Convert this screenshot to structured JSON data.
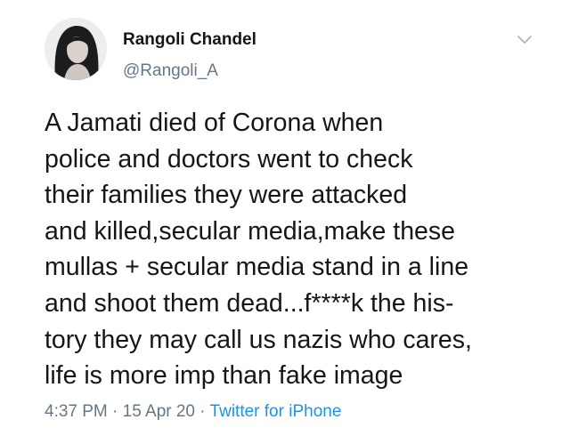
{
  "author": {
    "display_name": "Rangoli Chandel",
    "handle": "@Rangoli_A"
  },
  "tweet": {
    "lines": [
      "A Jamati died of Corona when",
      "police and doctors went to check",
      "their families they were attacked",
      "and killed,secular media,make these",
      "mullas + secular media stand in a line",
      "and shoot them dead...f****k the his-",
      "tory they may call us nazis who cares,",
      "life is more imp than fake image"
    ]
  },
  "meta": {
    "time": "4:37 PM",
    "separator": "·",
    "date": "15 Apr 20",
    "source": "Twitter for iPhone"
  },
  "icons": {
    "more": "chevron-down-icon",
    "avatar": "avatar"
  },
  "colors": {
    "text": "#14171a",
    "secondary": "#657786",
    "link": "#1b95e0"
  }
}
